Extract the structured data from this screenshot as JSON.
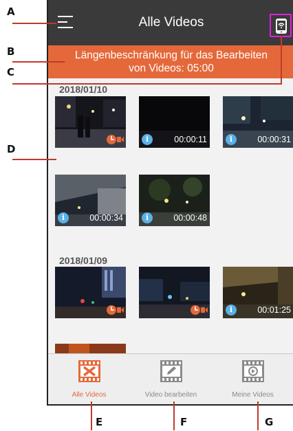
{
  "app": {
    "title": "Alle Videos",
    "menu_icon": "hamburger-menu-icon",
    "wifi_icon": "phone-wifi-icon"
  },
  "banner": {
    "line1": "Längenbeschränkung für das Bearbeiten",
    "line2": "von Videos: 05:00"
  },
  "groups": [
    {
      "date": "2018/01/10",
      "videos": [
        {
          "duration": "",
          "badge": "event-icon"
        },
        {
          "duration": "00:00:11",
          "badge": "info-icon"
        },
        {
          "duration": "00:00:31",
          "badge": "info-icon"
        },
        {
          "duration": "00:00:34",
          "badge": "info-icon"
        },
        {
          "duration": "00:00:48",
          "badge": "info-icon"
        }
      ]
    },
    {
      "date": "2018/01/09",
      "videos": [
        {
          "duration": "",
          "badge": "event-icon"
        },
        {
          "duration": "",
          "badge": "event-icon"
        },
        {
          "duration": "00:01:25",
          "badge": "info-icon"
        }
      ]
    }
  ],
  "info_glyph": "i",
  "tabs": [
    {
      "label": "Alle Videos",
      "icon": "film-x-icon",
      "active": true
    },
    {
      "label": "Video bearbeiten",
      "icon": "film-edit-icon",
      "active": false
    },
    {
      "label": "Meine Videos",
      "icon": "film-play-icon",
      "active": false
    }
  ],
  "callouts": {
    "a": "A",
    "b": "B",
    "c": "C",
    "d": "D",
    "e": "E",
    "f": "F",
    "g": "G"
  },
  "colors": {
    "appbar": "#3a3a3a",
    "accent": "#e5683a",
    "leader": "#c0392b",
    "info_badge": "#5ab1e8",
    "highlight": "#e020e0"
  }
}
